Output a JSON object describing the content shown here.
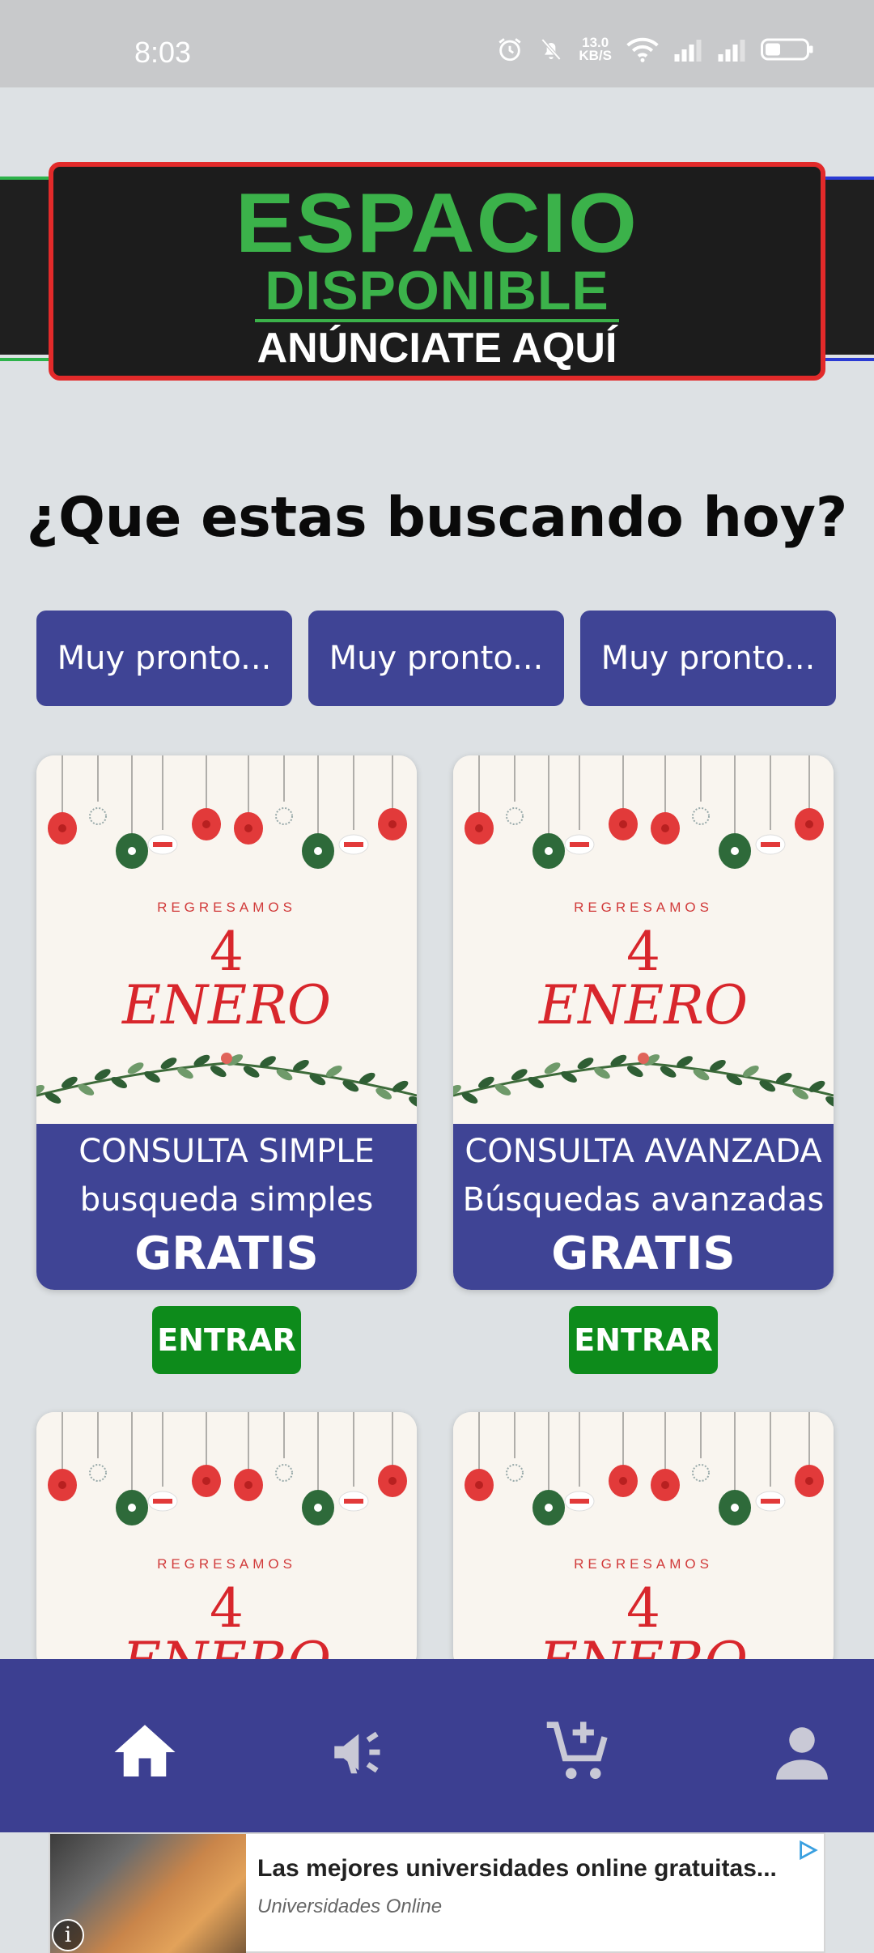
{
  "status_bar": {
    "time": "8:03",
    "net_speed_value": "13.0",
    "net_speed_unit": "KB/S",
    "icons": [
      "alarm-icon",
      "mute-icon",
      "wifi-icon",
      "signal-icon",
      "signal-icon-2",
      "battery-icon"
    ]
  },
  "banner": {
    "line1": "ESPACIO",
    "line2": "DISPONIBLE",
    "line3": "ANÚNCIATE AQUÍ"
  },
  "headline": "¿Que estas buscando hoy?",
  "soon_buttons": [
    "Muy pronto...",
    "Muy pronto...",
    "Muy pronto..."
  ],
  "cards": [
    {
      "image_text": {
        "kicker": "REGRESAMOS",
        "number": "4",
        "month": "ENERO"
      },
      "title": "CONSULTA SIMPLE",
      "subtitle": "busqueda simples",
      "price": "GRATIS",
      "button": "ENTRAR"
    },
    {
      "image_text": {
        "kicker": "REGRESAMOS",
        "number": "4",
        "month": "ENERO"
      },
      "title": "CONSULTA AVANZADA",
      "subtitle": "Búsquedas avanzadas",
      "price": "GRATIS",
      "button": "ENTRAR"
    },
    {
      "image_text": {
        "kicker": "REGRESAMOS",
        "number": "4",
        "month": "ENERO"
      }
    },
    {
      "image_text": {
        "kicker": "REGRESAMOS",
        "number": "4",
        "month": "ENERO"
      }
    }
  ],
  "bottom_nav": {
    "items": [
      "home-icon",
      "megaphone-icon",
      "cart-add-icon",
      "person-icon"
    ],
    "active": "home-icon",
    "active_color": "#ffffff",
    "inactive_color": "#c9c9d6"
  },
  "ad": {
    "title": "Las mejores universidades online gratuitas...",
    "advertiser": "Universidades Online",
    "info_glyph": "i"
  },
  "colors": {
    "primary": "#3f4495",
    "enter_button": "#0d8b1b",
    "background": "#dde1e4"
  }
}
